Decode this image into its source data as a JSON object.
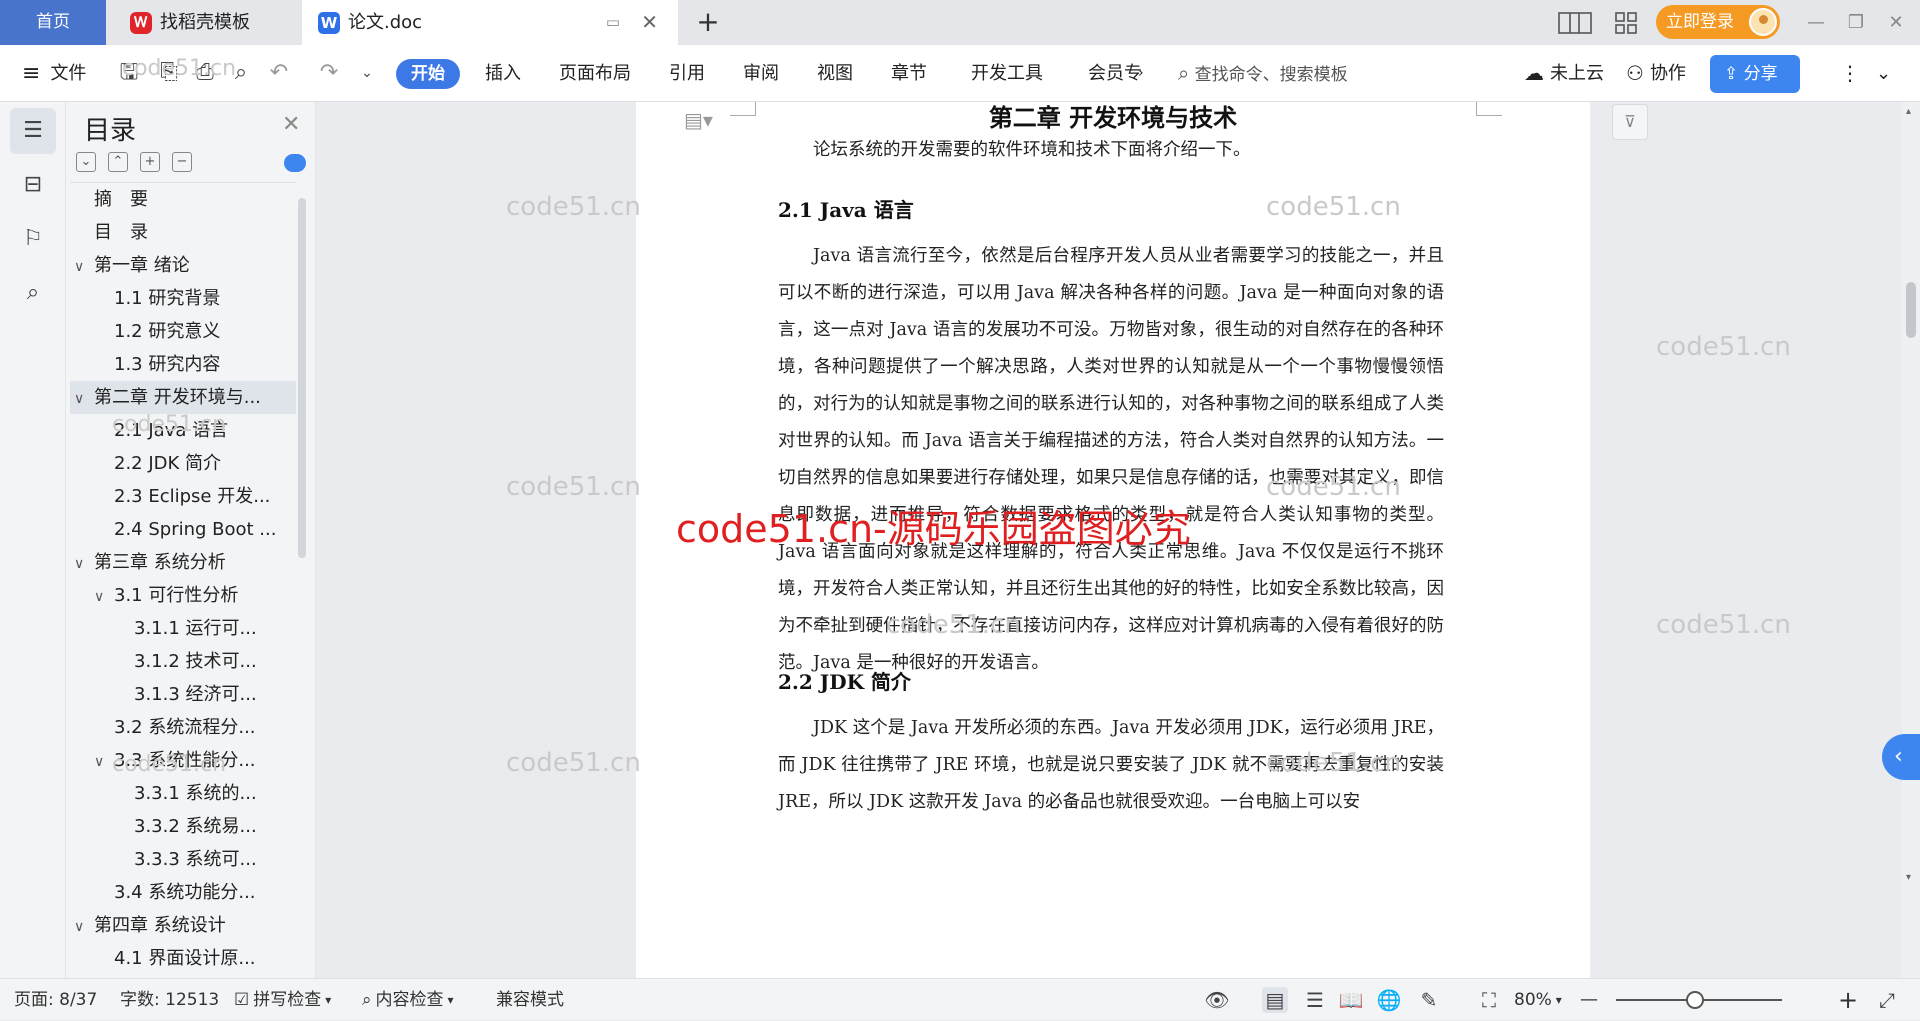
{
  "tabs": {
    "home": "首页",
    "templates": "找稻壳模板",
    "document": "论文.doc",
    "new_tab": "+"
  },
  "titlebar": {
    "login": "立即登录",
    "minimize": "—",
    "restore": "❐",
    "close": "✕"
  },
  "ribbon": {
    "file": "文件",
    "start": "开始",
    "menus": [
      "插入",
      "页面布局",
      "引用",
      "审阅",
      "视图",
      "章节",
      "开发工具",
      "会员专"
    ],
    "more": "›",
    "search_placeholder": "查找命令、搜索模板",
    "cloud": "未上云",
    "collab": "协作",
    "share": "分享"
  },
  "toc": {
    "title": "目录",
    "items": [
      {
        "label": "摘　要",
        "level": 1,
        "caret": ""
      },
      {
        "label": "目　录",
        "level": 1,
        "caret": ""
      },
      {
        "label": "第一章  绪论",
        "level": 1,
        "caret": "∨"
      },
      {
        "label": "1.1  研究背景",
        "level": 2,
        "caret": ""
      },
      {
        "label": "1.2  研究意义",
        "level": 2,
        "caret": ""
      },
      {
        "label": "1.3  研究内容",
        "level": 2,
        "caret": ""
      },
      {
        "label": "第二章  开发环境与...",
        "level": 1,
        "caret": "∨",
        "selected": true
      },
      {
        "label": "2.1 Java 语言",
        "level": 2,
        "caret": ""
      },
      {
        "label": "2.2 JDK 简介",
        "level": 2,
        "caret": ""
      },
      {
        "label": "2.3 Eclipse 开发...",
        "level": 2,
        "caret": ""
      },
      {
        "label": "2.4 Spring Boot ...",
        "level": 2,
        "caret": ""
      },
      {
        "label": "第三章  系统分析",
        "level": 1,
        "caret": "∨"
      },
      {
        "label": "3.1 可行性分析",
        "level": 2,
        "caret": "∨"
      },
      {
        "label": "3.1.1 运行可...",
        "level": 3,
        "caret": ""
      },
      {
        "label": "3.1.2 技术可...",
        "level": 3,
        "caret": ""
      },
      {
        "label": "3.1.3 经济可...",
        "level": 3,
        "caret": ""
      },
      {
        "label": "3.2 系统流程分...",
        "level": 2,
        "caret": ""
      },
      {
        "label": "3.3  系统性能分...",
        "level": 2,
        "caret": "∨"
      },
      {
        "label": "3.3.1 系统的...",
        "level": 3,
        "caret": ""
      },
      {
        "label": "3.3.2 系统易...",
        "level": 3,
        "caret": ""
      },
      {
        "label": "3.3.3 系统可...",
        "level": 3,
        "caret": ""
      },
      {
        "label": "3.4 系统功能分...",
        "level": 2,
        "caret": ""
      },
      {
        "label": "第四章  系统设计",
        "level": 1,
        "caret": "∨"
      },
      {
        "label": "4.1 界面设计原...",
        "level": 2,
        "caret": ""
      }
    ]
  },
  "document": {
    "chapter_title": "第二章  开发环境与技术",
    "intro": "论坛系统的开发需要的软件环境和技术下面将介绍一下。",
    "h_java": "2.1 Java 语言",
    "p_java": "Java 语言流行至今，依然是后台程序开发人员从业者需要学习的技能之一，并且可以不断的进行深造，可以用 Java 解决各种各样的问题。Java 是一种面向对象的语言，这一点对 Java 语言的发展功不可没。万物皆对象，很生动的对自然存在的各种环境，各种问题提供了一个解决思路，人类对世界的认知就是从一个一个事物慢慢领悟的，对行为的认知就是事物之间的联系进行认知的，对各种事物之间的联系组成了人类对世界的认知。而 Java 语言关于编程描述的方法，符合人类对自然界的认知方法。一切自然界的信息如果要进行存储处理，如果只是信息存储的话，也需要对其定义，即信息即数据，进而推导，符合数据要求格式的类型，就是符合人类认知事物的类型。Java 语言面向对象就是这样理解的，符合人类正常思维。Java 不仅仅是运行不挑环境，开发符合人类正常认知，并且还衍生出其他的好的特性，比如安全系数比较高，因为不牵扯到硬件指针，不存在直接访问内存，这样应对计算机病毒的入侵有着很好的防范。Java 是一种很好的开发语言。",
    "h_jdk": "2.2 JDK 简介",
    "p_jdk": "JDK 这个是 Java 开发所必须的东西。Java 开发必须用 JDK，运行必须用 JRE，而 JDK 往往携带了 JRE 环境，也就是说只要安装了 JDK 就不需要再去重复性的安装 JRE，所以 JDK 这款开发 Java 的必备品也就很受欢迎。一台电脑上可以安"
  },
  "watermarks": {
    "light": "code51.cn",
    "red": "code51.cn-源码乐园盗图必究"
  },
  "statusbar": {
    "page": "页面: 8/37",
    "words": "字数: 12513",
    "spell": "拼写检查",
    "content_check": "内容检查",
    "compat": "兼容模式",
    "zoom": "80%",
    "zoom_out": "—",
    "zoom_in": "+"
  }
}
